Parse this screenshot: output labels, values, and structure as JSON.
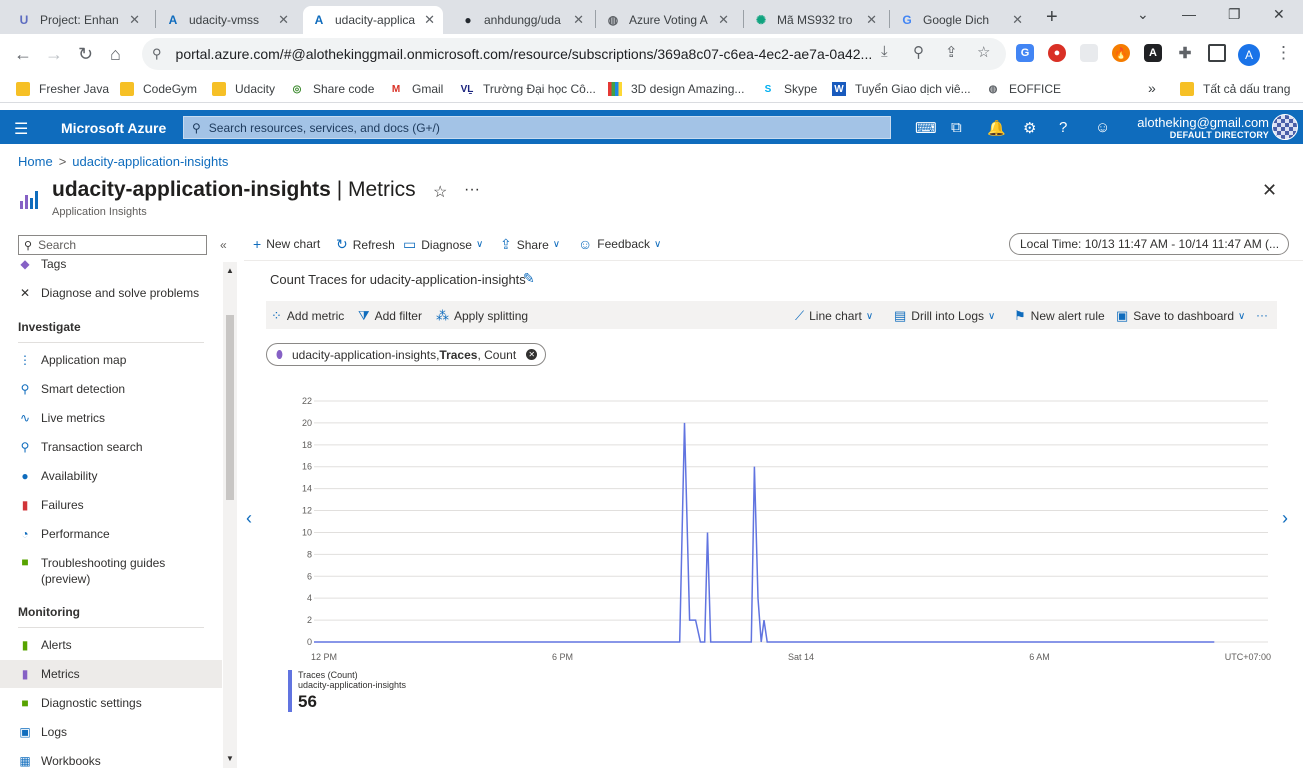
{
  "browser": {
    "tabs": [
      {
        "title": "Project: Enhan",
        "icon": "udacity-icon",
        "color": "#5c6bc0",
        "glyph": "U"
      },
      {
        "title": "udacity-vmss",
        "icon": "azure-icon",
        "color": "#0f6cbd",
        "glyph": "A"
      },
      {
        "title": "udacity-applica",
        "icon": "azure-icon",
        "color": "#0f6cbd",
        "glyph": "A",
        "active": true
      },
      {
        "title": "anhdungg/uda",
        "icon": "github-icon",
        "color": "#24292f",
        "glyph": "●"
      },
      {
        "title": "Azure Voting A",
        "icon": "globe-icon",
        "color": "#5f6368",
        "glyph": "◍"
      },
      {
        "title": "Mã MS932 tro",
        "icon": "chatgpt-icon",
        "color": "#10a37f",
        "glyph": "✺"
      },
      {
        "title": "Google Dich",
        "icon": "google-translate-icon",
        "color": "#4285f4",
        "glyph": "G"
      }
    ],
    "url": "portal.azure.com/#@alothekinggmail.onmicrosoft.com/resource/subscriptions/369a8c07-c6ea-4ec2-ae7a-0a42...",
    "profile_initial": "A",
    "bookmarks": [
      {
        "label": "Fresher Java",
        "icon": "folder-icon"
      },
      {
        "label": "CodeGym",
        "icon": "folder-icon"
      },
      {
        "label": "Udacity",
        "icon": "folder-icon"
      },
      {
        "label": "Share code",
        "icon": "sharecode-icon"
      },
      {
        "label": "Gmail",
        "icon": "gmail-icon"
      },
      {
        "label": "Trường Đại học Cô...",
        "icon": "university-icon"
      },
      {
        "label": "3D design Amazing...",
        "icon": "tinkercad-icon"
      },
      {
        "label": "Skype",
        "icon": "skype-icon"
      },
      {
        "label": "Tuyển Giao dịch viê...",
        "icon": "word-icon"
      },
      {
        "label": "EOFFICE",
        "icon": "globe-icon"
      }
    ],
    "bookmarks_more": "»",
    "all_bookmarks": "Tất cả dấu trang"
  },
  "azure": {
    "brand": "Microsoft Azure",
    "search_placeholder": "Search resources, services, and docs (G+/)",
    "user_email": "alotheking@gmail.com",
    "user_directory": "DEFAULT DIRECTORY"
  },
  "breadcrumb": {
    "home": "Home",
    "resource": "udacity-application-insights"
  },
  "page": {
    "title_bold": "udacity-application-insights",
    "title_rest": " | Metrics",
    "subtitle": "Application Insights"
  },
  "sidebar": {
    "search_placeholder": "Search",
    "items_top": [
      {
        "label": "Tags",
        "icon": "tag-icon"
      },
      {
        "label": "Diagnose and solve problems",
        "icon": "wrench-icon"
      }
    ],
    "sections": [
      {
        "header": "Investigate",
        "items": [
          {
            "label": "Application map",
            "icon": "application-map-icon"
          },
          {
            "label": "Smart detection",
            "icon": "smart-detection-icon"
          },
          {
            "label": "Live metrics",
            "icon": "live-metrics-icon"
          },
          {
            "label": "Transaction search",
            "icon": "search-icon"
          },
          {
            "label": "Availability",
            "icon": "globe-icon"
          },
          {
            "label": "Failures",
            "icon": "failures-icon"
          },
          {
            "label": "Performance",
            "icon": "performance-icon"
          },
          {
            "label": "Troubleshooting guides\n(preview)",
            "icon": "notebook-icon"
          }
        ]
      },
      {
        "header": "Monitoring",
        "items": [
          {
            "label": "Alerts",
            "icon": "alerts-icon"
          },
          {
            "label": "Metrics",
            "icon": "metrics-icon",
            "selected": true
          },
          {
            "label": "Diagnostic settings",
            "icon": "diagnostic-settings-icon"
          },
          {
            "label": "Logs",
            "icon": "logs-icon"
          },
          {
            "label": "Workbooks",
            "icon": "workbooks-icon"
          }
        ]
      }
    ]
  },
  "commandbar": {
    "new_chart": "New chart",
    "refresh": "Refresh",
    "diagnose": "Diagnose",
    "share": "Share",
    "feedback": "Feedback",
    "time_range": "Local Time: 10/13 11:47 AM - 10/14 11:47 AM (..."
  },
  "chart": {
    "title": "Count Traces for udacity-application-insights",
    "toolbar": {
      "add_metric": "Add metric",
      "add_filter": "Add filter",
      "apply_splitting": "Apply splitting",
      "line_chart": "Line chart",
      "drill_into_logs": "Drill into Logs",
      "new_alert_rule": "New alert rule",
      "save_to_dashboard": "Save to dashboard"
    },
    "pill": {
      "resource": "udacity-application-insights, ",
      "metric": "Traces",
      "aggregation": ", Count"
    },
    "legend": {
      "series": "Traces (Count)",
      "resource": "udacity-application-insights",
      "total": "56"
    },
    "line_color": "#6174e0"
  },
  "chart_data": {
    "type": "line",
    "x_tick_labels": [
      "12 PM",
      "6 PM",
      "Sat 14",
      "6 AM",
      "UTC+07:00"
    ],
    "y_ticks": [
      0,
      2,
      4,
      6,
      8,
      10,
      12,
      14,
      16,
      18,
      20,
      22
    ],
    "ylim": [
      0,
      22
    ],
    "x_range_hours": [
      0,
      24
    ],
    "series": [
      {
        "name": "Traces (Count)",
        "points": [
          [
            0,
            0
          ],
          [
            9.2,
            0
          ],
          [
            9.32,
            20
          ],
          [
            9.45,
            2
          ],
          [
            9.6,
            2
          ],
          [
            9.72,
            0
          ],
          [
            9.83,
            0
          ],
          [
            9.9,
            10
          ],
          [
            9.98,
            0
          ],
          [
            11.0,
            0
          ],
          [
            11.08,
            16
          ],
          [
            11.17,
            4
          ],
          [
            11.25,
            0
          ],
          [
            11.32,
            2
          ],
          [
            11.4,
            0
          ],
          [
            22.65,
            0
          ]
        ]
      }
    ],
    "grid": true
  }
}
